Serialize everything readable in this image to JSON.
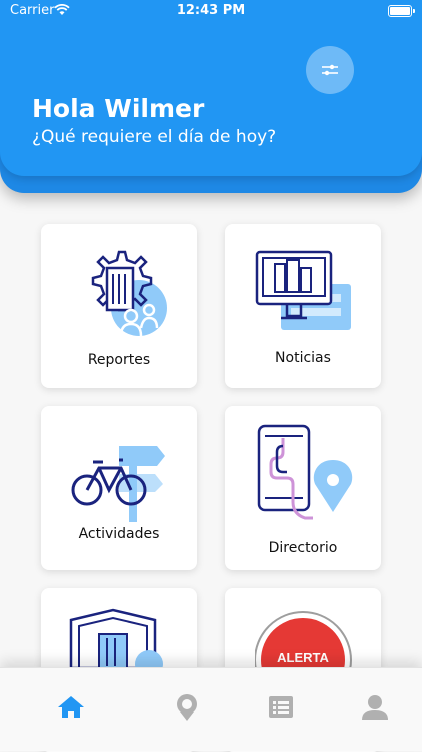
{
  "status_bar": {
    "carrier": "Carrier",
    "time": "12:43 PM"
  },
  "header": {
    "greeting": "Hola Wilmer",
    "subtitle": "¿Qué requiere el día de hoy?"
  },
  "cards": [
    {
      "label": "Reportes",
      "icon": "building-gear-people-icon"
    },
    {
      "label": "Noticias",
      "icon": "monitor-news-icon"
    },
    {
      "label": "Actividades",
      "icon": "bicycle-signpost-icon"
    },
    {
      "label": "Directorio",
      "icon": "phone-map-pin-icon"
    },
    {
      "label": "",
      "icon": "shield-building-icon"
    },
    {
      "label": "",
      "alert_label": "ALERTA",
      "icon": "alert-button-icon"
    }
  ],
  "tabbar": {
    "items": [
      {
        "icon": "home-icon",
        "active": true
      },
      {
        "icon": "location-icon",
        "active": false
      },
      {
        "icon": "list-icon",
        "active": false
      },
      {
        "icon": "user-icon",
        "active": false
      }
    ],
    "active_color": "#2196f3",
    "inactive_color": "#b0b0b0"
  },
  "colors": {
    "header": "#2196f3",
    "icon_navy": "#1a237e",
    "icon_light": "#90caf9",
    "alert_red": "#e53935"
  }
}
